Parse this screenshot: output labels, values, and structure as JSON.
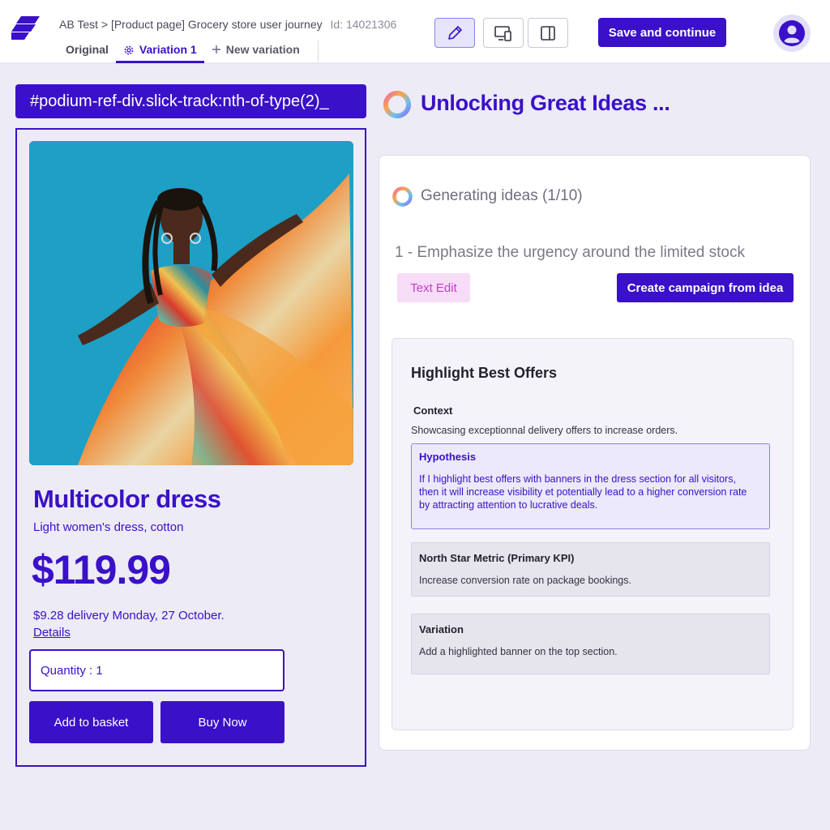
{
  "header": {
    "breadcrumb": "AB Test > [Product page] Grocery store user journey",
    "id_label": "Id: 14021306",
    "tabs": [
      {
        "label": "Original"
      },
      {
        "label": "Variation 1"
      },
      {
        "label": "New variation"
      }
    ],
    "save_label": "Save and continue"
  },
  "product": {
    "selector": "#podium-ref-div.slick-track:nth-of-type(2)_",
    "title": "Multicolor dress",
    "subtitle": "Light women's dress, cotton",
    "price": "$119.99",
    "delivery": "$9.28 delivery Monday, 27 October.",
    "details_link": "Details",
    "quantity": "Quantity : 1",
    "add_to_basket": "Add to basket",
    "buy_now": "Buy Now"
  },
  "ideas": {
    "heading": "Unlocking Great Ideas ...",
    "status": "Generating ideas (1/10)",
    "idea": "1 - Emphasize the urgency around the limited stock",
    "tag": "Text Edit",
    "create_label": "Create campaign from idea"
  },
  "offer": {
    "title": "Highlight Best Offers",
    "context_label": "Context",
    "context_text": "Showcasing exceptionnal delivery offers to increase orders.",
    "hypothesis_label": "Hypothesis",
    "hypothesis_lines": [
      "If I highlight best offers with banners in the dress section for all visitors,",
      "then it will increase visibility et potentially lead to a higher conversion rate",
      "by attracting attention to lucrative deals."
    ],
    "kpi_label": "North Star Metric (Primary KPI)",
    "kpi_text": "Increase conversion rate on package bookings.",
    "variation_label": "Variation",
    "variation_text": "Add a highlighted banner on the top section."
  },
  "colors": {
    "brand": "#3a10c8",
    "tag_bg": "#f7dcf7",
    "tag_text": "#c23ccc"
  },
  "icons": [
    "logo-icon",
    "settings-icon",
    "plus-icon",
    "pencil-icon",
    "responsive-devices-icon",
    "side-panel-icon",
    "user-icon",
    "loading-ring-icon"
  ]
}
